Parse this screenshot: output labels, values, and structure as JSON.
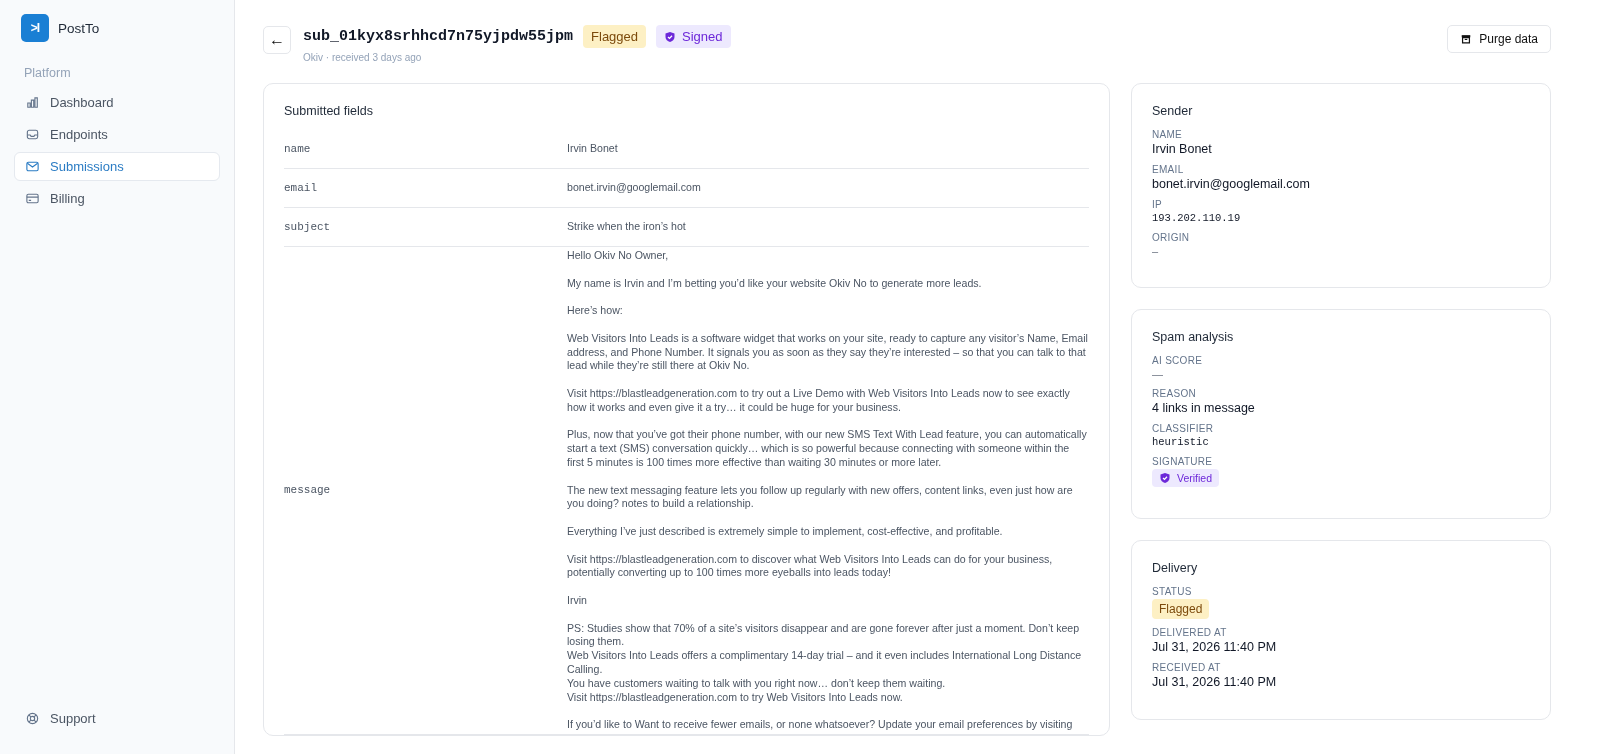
{
  "sidebar": {
    "brand": "PostTo",
    "logo_glyph": ">I",
    "section": "Platform",
    "items": [
      {
        "label": "Dashboard",
        "kind": "chart",
        "selected": false
      },
      {
        "label": "Endpoints",
        "kind": "inbox",
        "selected": false
      },
      {
        "label": "Submissions",
        "kind": "mail",
        "selected": true
      },
      {
        "label": "Billing",
        "kind": "card",
        "selected": false
      }
    ],
    "footer": {
      "label": "Support",
      "kind": "lifebuoy"
    }
  },
  "header": {
    "back": "←",
    "title": "sub_01kyx8srhhcd7n75yjpdw55jpm",
    "badges": [
      {
        "label": "Flagged",
        "kind": "warning"
      },
      {
        "label": "Signed",
        "kind": "signed"
      }
    ],
    "subtitle": "Okiv · received 3 days ago",
    "action": "Purge data"
  },
  "fields": {
    "title": "Submitted fields",
    "rows": [
      {
        "key": "name",
        "value": [
          [
            "Irvin Bonet"
          ]
        ]
      },
      {
        "key": "email",
        "value": [
          [
            "bonet.irvin@googlemail.com"
          ]
        ]
      },
      {
        "key": "subject",
        "value": [
          [
            "Strike when the iron’s hot"
          ]
        ]
      },
      {
        "key": "message",
        "value": [
          [
            "Hello Okiv No Owner,"
          ],
          [
            "My name is Irvin and I’m betting you’d like your website Okiv No to generate more leads."
          ],
          [
            "Here’s how:"
          ],
          [
            "Web Visitors Into Leads is a software widget that works on your site, ready to capture any visitor’s Name, Email address, and Phone Number. It signals you as soon as they say they’re interested – so that you can talk to that lead while they’re still there at Okiv No."
          ],
          [
            "Visit https://blastleadgeneration.com to try out a Live Demo with Web Visitors Into Leads now to see exactly how it works and even give it a try… it could be huge for your business."
          ],
          [
            "Plus, now that you’ve got their phone number, with our new SMS Text With Lead feature, you can automatically start a text (SMS) conversation quickly… which is so powerful because connecting with someone within the first 5 minutes is 100 times more effective than waiting 30 minutes or more later."
          ],
          [
            "The new text messaging feature lets you follow up regularly with new offers, content links, even just how are you doing? notes to build a relationship."
          ],
          [
            "Everything I’ve just described is extremely simple to implement, cost-effective, and profitable."
          ],
          [
            "Visit https://blastleadgeneration.com to discover what Web Visitors Into Leads can do for your business, potentially converting up to 100 times more eyeballs into leads today!"
          ],
          [
            "Irvin"
          ],
          [
            "PS: Studies show that 70% of a site’s visitors disappear and are gone forever after just a moment. Don’t keep losing them.",
            "Web Visitors Into Leads offers a complimentary 14-day trial – and it even includes International Long Distance Calling.",
            "You have customers waiting to talk with you right now… don’t keep them waiting.",
            "Visit https://blastleadgeneration.com to try Web Visitors Into Leads now."
          ],
          [
            "If you’d like to Want to receive fewer emails, or none whatsoever? Update your email preferences by visiting"
          ]
        ]
      }
    ]
  },
  "cards": [
    {
      "title": "Sender",
      "items": [
        {
          "label": "NAME",
          "value": "Irvin Bonet",
          "kind": "text"
        },
        {
          "label": "EMAIL",
          "value": "bonet.irvin@googlemail.com",
          "kind": "text"
        },
        {
          "label": "IP",
          "value": "193.202.110.19",
          "kind": "mono"
        },
        {
          "label": "ORIGIN",
          "value": "–",
          "kind": "muted"
        }
      ]
    },
    {
      "title": "Spam analysis",
      "items": [
        {
          "label": "AI SCORE",
          "value": "—",
          "kind": "muted"
        },
        {
          "label": "REASON",
          "value": "4 links in message",
          "kind": "text"
        },
        {
          "label": "CLASSIFIER",
          "value": "heuristic",
          "kind": "mono"
        },
        {
          "label": "SIGNATURE",
          "value": "Verified",
          "kind": "signed"
        }
      ]
    },
    {
      "title": "Delivery",
      "items": [
        {
          "label": "STATUS",
          "value": "Flagged",
          "kind": "warning"
        },
        {
          "label": "DELIVERED AT",
          "value": "Jul 31, 2026 11:40 PM",
          "kind": "text"
        },
        {
          "label": "RECEIVED AT",
          "value": "Jul 31, 2026 11:40 PM",
          "kind": "text"
        }
      ]
    }
  ]
}
